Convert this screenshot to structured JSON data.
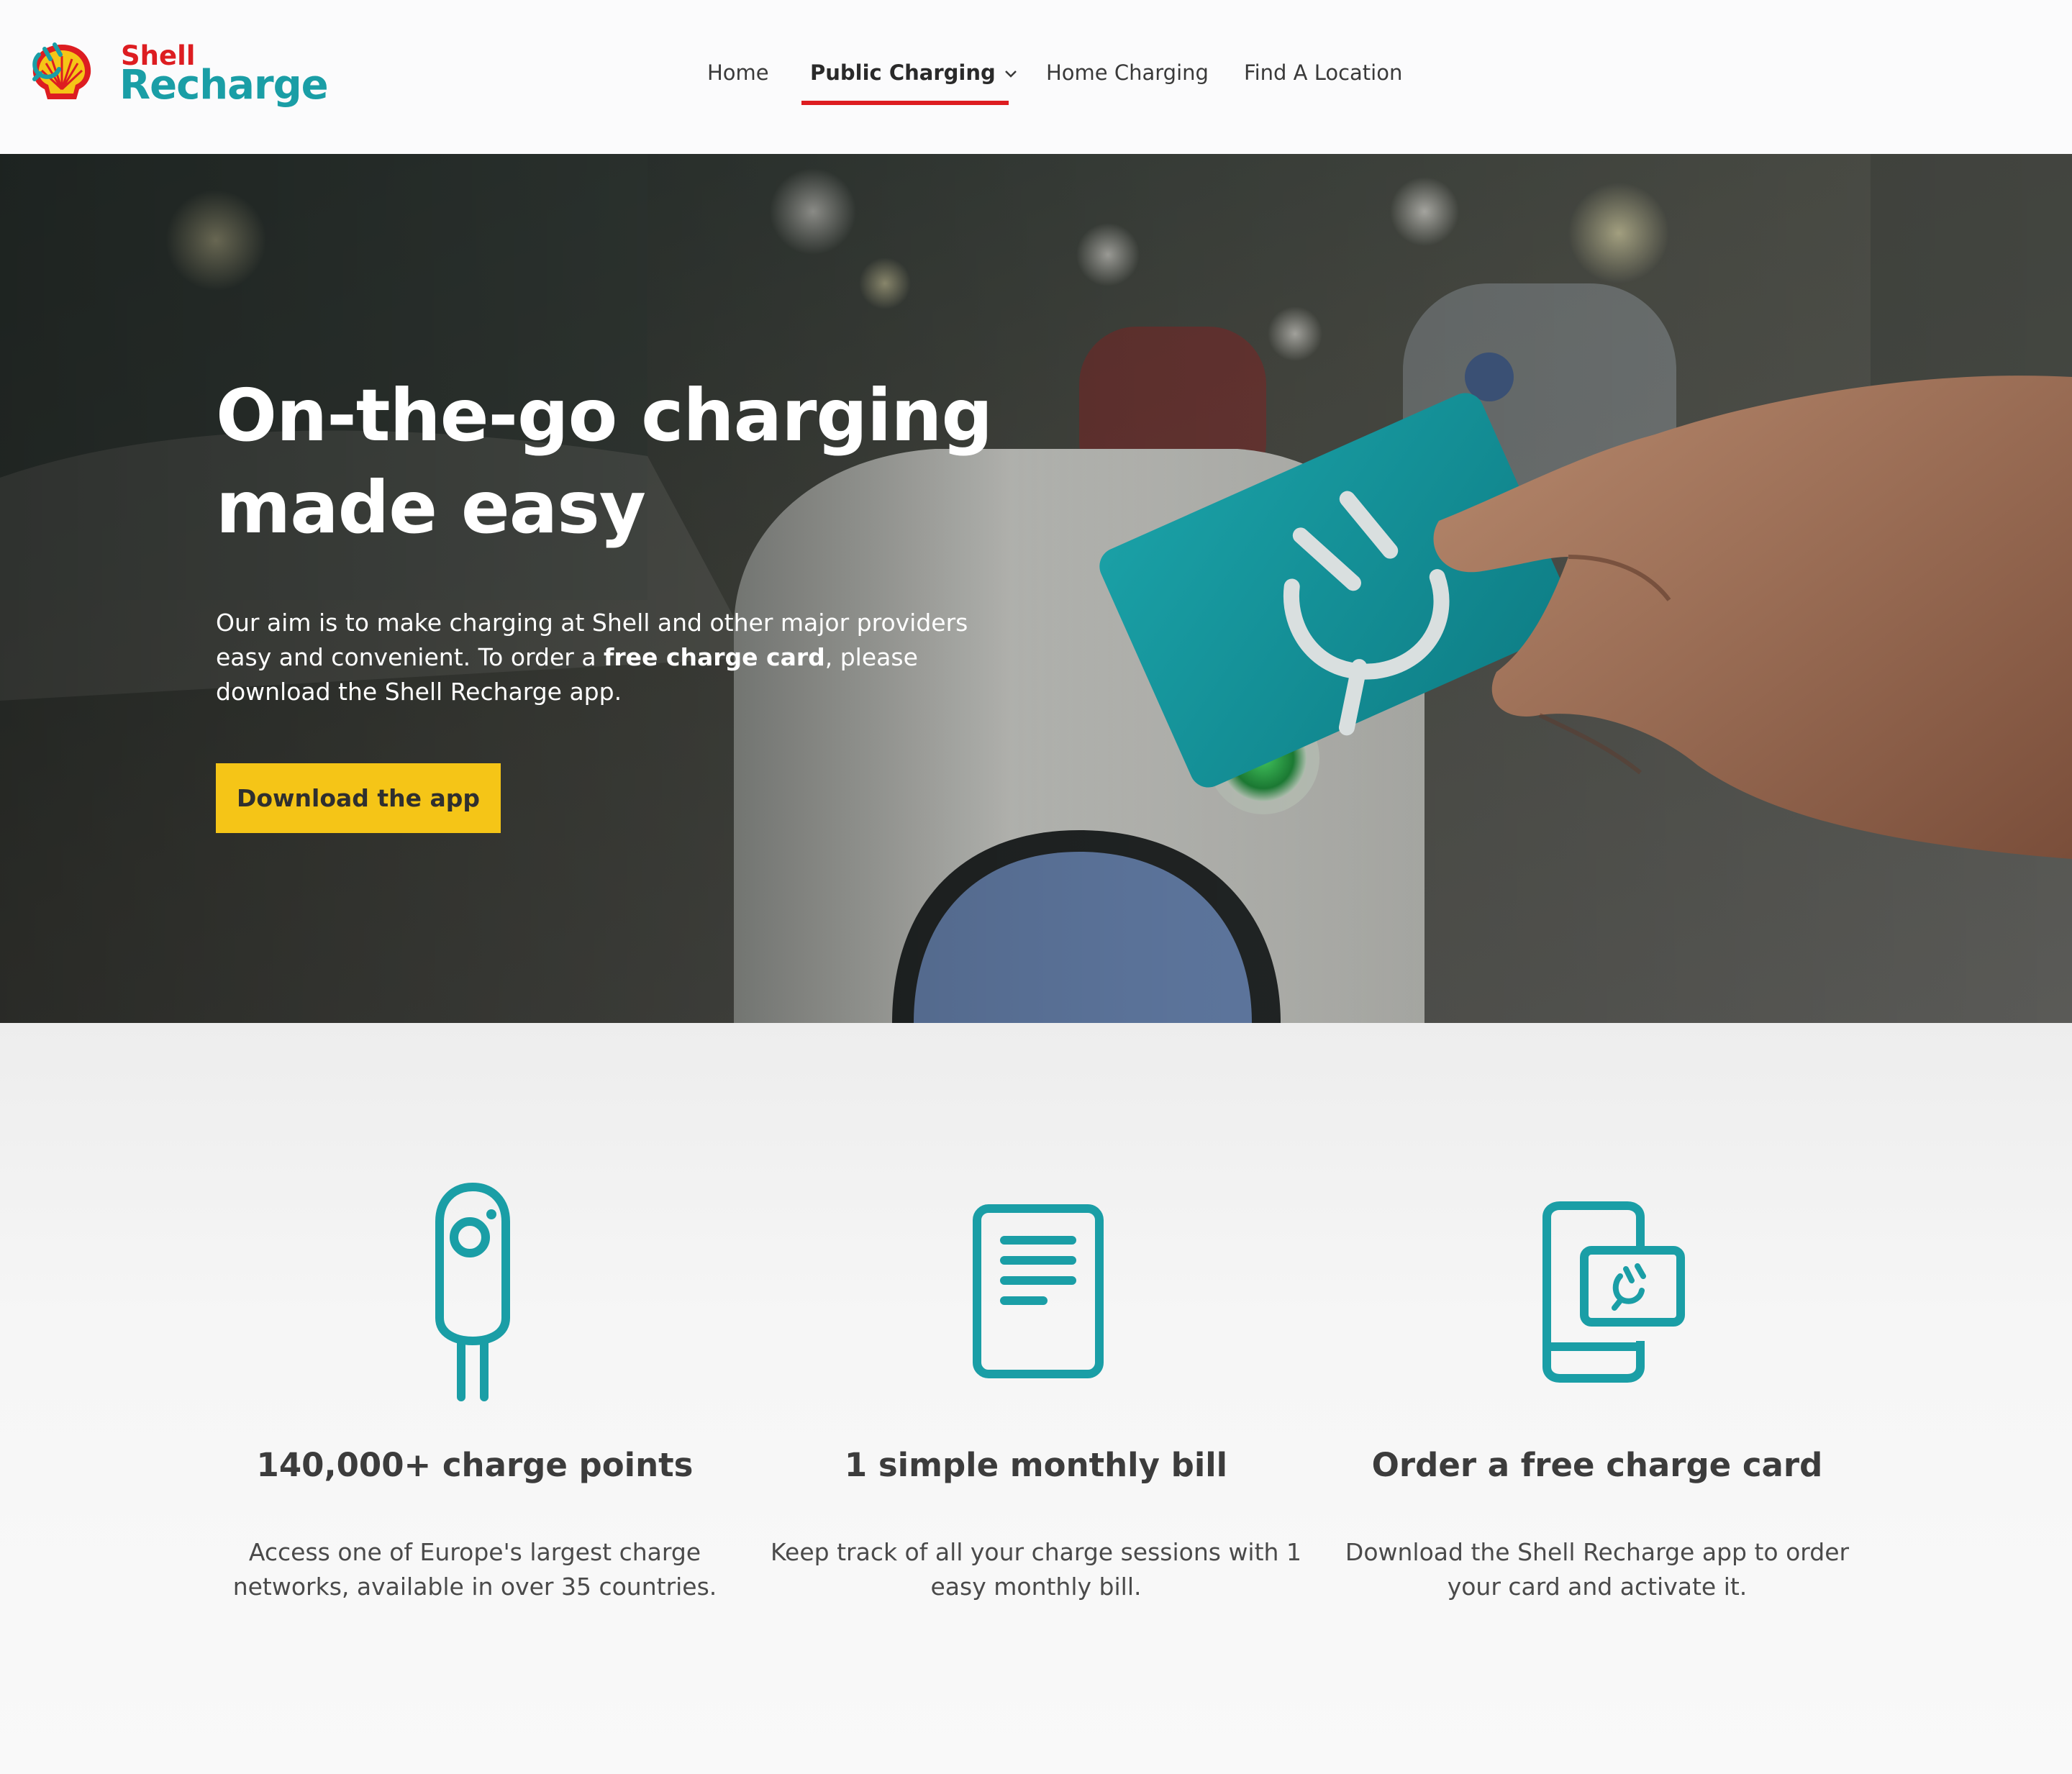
{
  "brand": {
    "top_word": "Shell",
    "main_word": "Recharge",
    "red": "#dd1d21",
    "yellow": "#f5c517",
    "teal": "#1a9ea6"
  },
  "nav": {
    "items": [
      {
        "label": "Home"
      },
      {
        "label": "Public Charging"
      },
      {
        "label": "Home Charging"
      },
      {
        "label": "Find A Location"
      }
    ],
    "active_index": 1
  },
  "hero": {
    "title_line1": "On-the-go charging",
    "title_line2": "made easy",
    "text_part1": "Our aim is to make charging at Shell and other major providers easy and convenient. To order a ",
    "text_bold": "free charge card",
    "text_part2": ", please download the Shell Recharge app.",
    "cta_label": "Download the app"
  },
  "features": [
    {
      "icon": "charge-point-icon",
      "title": "140,000+ charge points",
      "text_line1": "Access one of Europe's largest charge",
      "text_line2": "networks, available in over 35 countries."
    },
    {
      "icon": "bill-document-icon",
      "title": "1 simple monthly bill",
      "text_line1": "Keep track of all your charge sessions with 1",
      "text_line2": "easy monthly bill."
    },
    {
      "icon": "phone-card-icon",
      "title": "Order a free charge card",
      "text_line1": "Download the Shell Recharge app to order",
      "text_line2": "your card and activate it."
    }
  ]
}
